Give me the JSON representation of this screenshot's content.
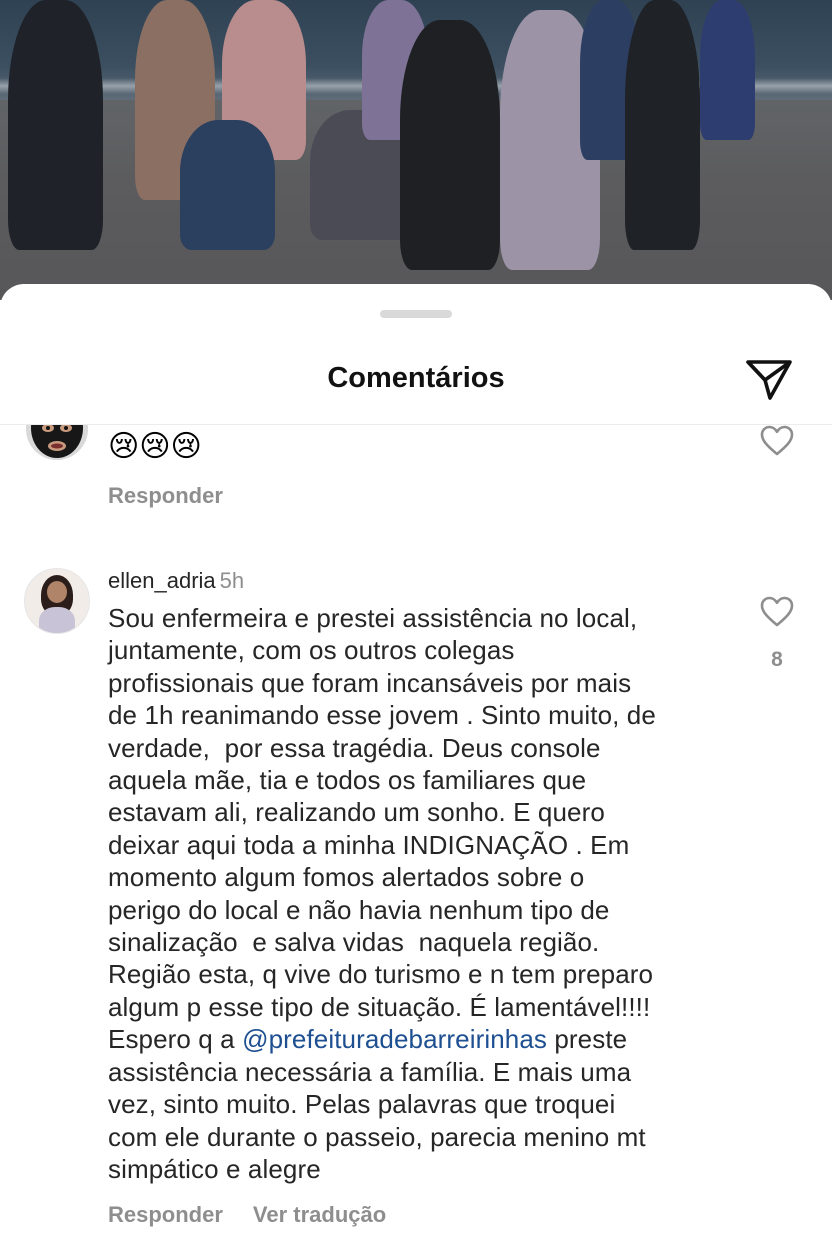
{
  "sheet": {
    "title": "Comentários"
  },
  "comments": [
    {
      "avatar": "balaclava-avatar",
      "text": "😢😢😢",
      "reply_label": "Responder"
    },
    {
      "username": "ellen_adria",
      "time": "5h",
      "text_before_mention": "Sou enfermeira e prestei assistência no local,\njuntamente, com os outros colegas\nprofissionais que foram incansáveis por mais\nde 1h reanimando esse jovem . Sinto muito, de\nverdade,  por essa tragédia. Deus console\naquela mãe, tia e todos os familiares que\nestavam ali, realizando um sonho. E quero\ndeixar aqui toda a minha INDIGNAÇÃO . Em\nmomento algum fomos alertados sobre o\nperigo do local e não havia nenhum tipo de\nsinalização  e salva vidas  naquela região.\nRegião esta, q vive do turismo e n tem preparo\nalgum p esse tipo de situação. É lamentável!!!!\nEspero q a ",
      "mention": "@prefeituradebarreirinhas",
      "text_after_mention": " preste\nassistência necessária a família. E mais uma\nvez, sinto muito. Pelas palavras que troquei\ncom ele durante o passeio, parecia menino mt\nsimpático e alegre",
      "likes": "8",
      "reply_label": "Responder",
      "translate_label": "Ver tradução"
    }
  ],
  "icons": {
    "share": "paper-plane-icon",
    "like": "heart-outline-icon"
  },
  "colors": {
    "mention": "#1d4f91",
    "secondary_text": "#8e8e8e",
    "primary_text": "#262626"
  }
}
